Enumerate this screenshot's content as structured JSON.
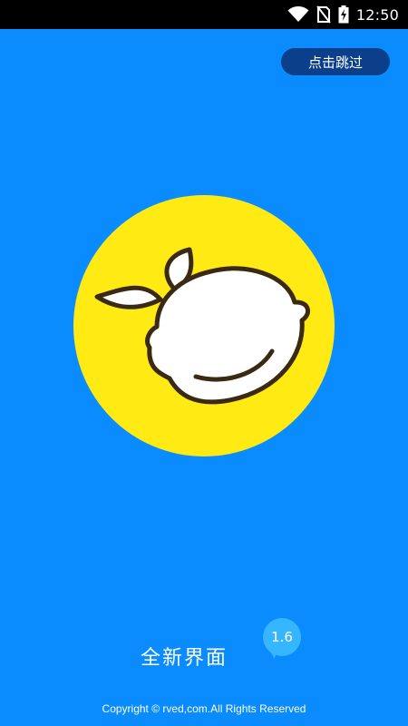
{
  "status_bar": {
    "time": "12:50",
    "icons": [
      "wifi-icon",
      "no-sim-icon",
      "battery-charging-icon"
    ]
  },
  "skip": {
    "label": "点击跳过"
  },
  "logo": {
    "icon": "lemon-logo-icon",
    "colors": {
      "background": "#0a8cff",
      "circle": "#ffea14",
      "fruit": "#ffffff",
      "outline": "#3b2a13"
    }
  },
  "footer": {
    "brand": "全新界面",
    "version": "1.6",
    "copyright": "Copyright © rved,com.All Rights Reserved"
  }
}
